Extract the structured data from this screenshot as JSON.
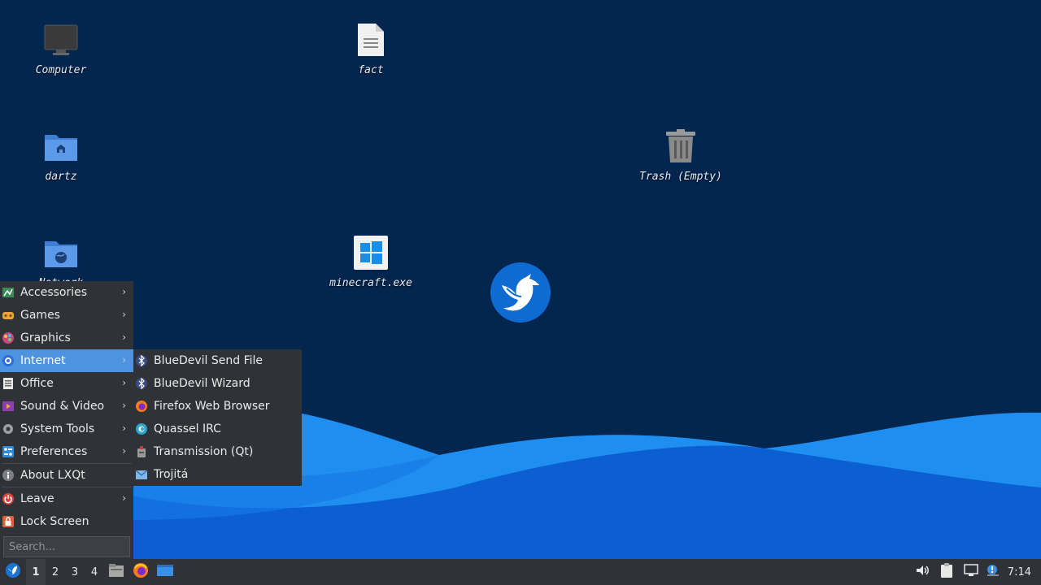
{
  "desktop": {
    "icons": [
      {
        "label": "Computer"
      },
      {
        "label": "fact"
      },
      {
        "label": "dartz"
      },
      {
        "label": "Trash (Empty)"
      },
      {
        "label": "Network"
      },
      {
        "label": "minecraft.exe"
      }
    ]
  },
  "menu": {
    "items": [
      {
        "label": "Accessories",
        "icon": "accessories-icon"
      },
      {
        "label": "Games",
        "icon": "games-icon"
      },
      {
        "label": "Graphics",
        "icon": "graphics-icon"
      },
      {
        "label": "Internet",
        "icon": "internet-icon"
      },
      {
        "label": "Office",
        "icon": "office-icon"
      },
      {
        "label": "Sound & Video",
        "icon": "sound-video-icon"
      },
      {
        "label": "System Tools",
        "icon": "system-tools-icon"
      },
      {
        "label": "Preferences",
        "icon": "preferences-icon"
      },
      {
        "label": "About LXQt",
        "icon": "about-icon"
      },
      {
        "label": "Leave",
        "icon": "power-icon"
      },
      {
        "label": "Lock Screen",
        "icon": "lock-icon"
      }
    ],
    "active_item": "Internet",
    "search_placeholder": "Search..."
  },
  "submenu": {
    "items": [
      {
        "label": "BlueDevil Send File",
        "icon": "bluetooth-icon"
      },
      {
        "label": "BlueDevil Wizard",
        "icon": "bluetooth-icon"
      },
      {
        "label": "Firefox Web Browser",
        "icon": "firefox-icon"
      },
      {
        "label": "Quassel IRC",
        "icon": "quassel-icon"
      },
      {
        "label": "Transmission (Qt)",
        "icon": "transmission-icon"
      },
      {
        "label": "Trojitá",
        "icon": "mail-icon"
      }
    ]
  },
  "taskbar": {
    "desktops": [
      "1",
      "2",
      "3",
      "4"
    ],
    "current_desktop": "1",
    "clock": "7:14"
  },
  "colors": {
    "desktop_bg": "#03264f",
    "wave_light": "#1e8ff0",
    "wave_dark": "#0b5fd0",
    "panel_bg": "#2f3236",
    "highlight": "#4e93e0"
  }
}
